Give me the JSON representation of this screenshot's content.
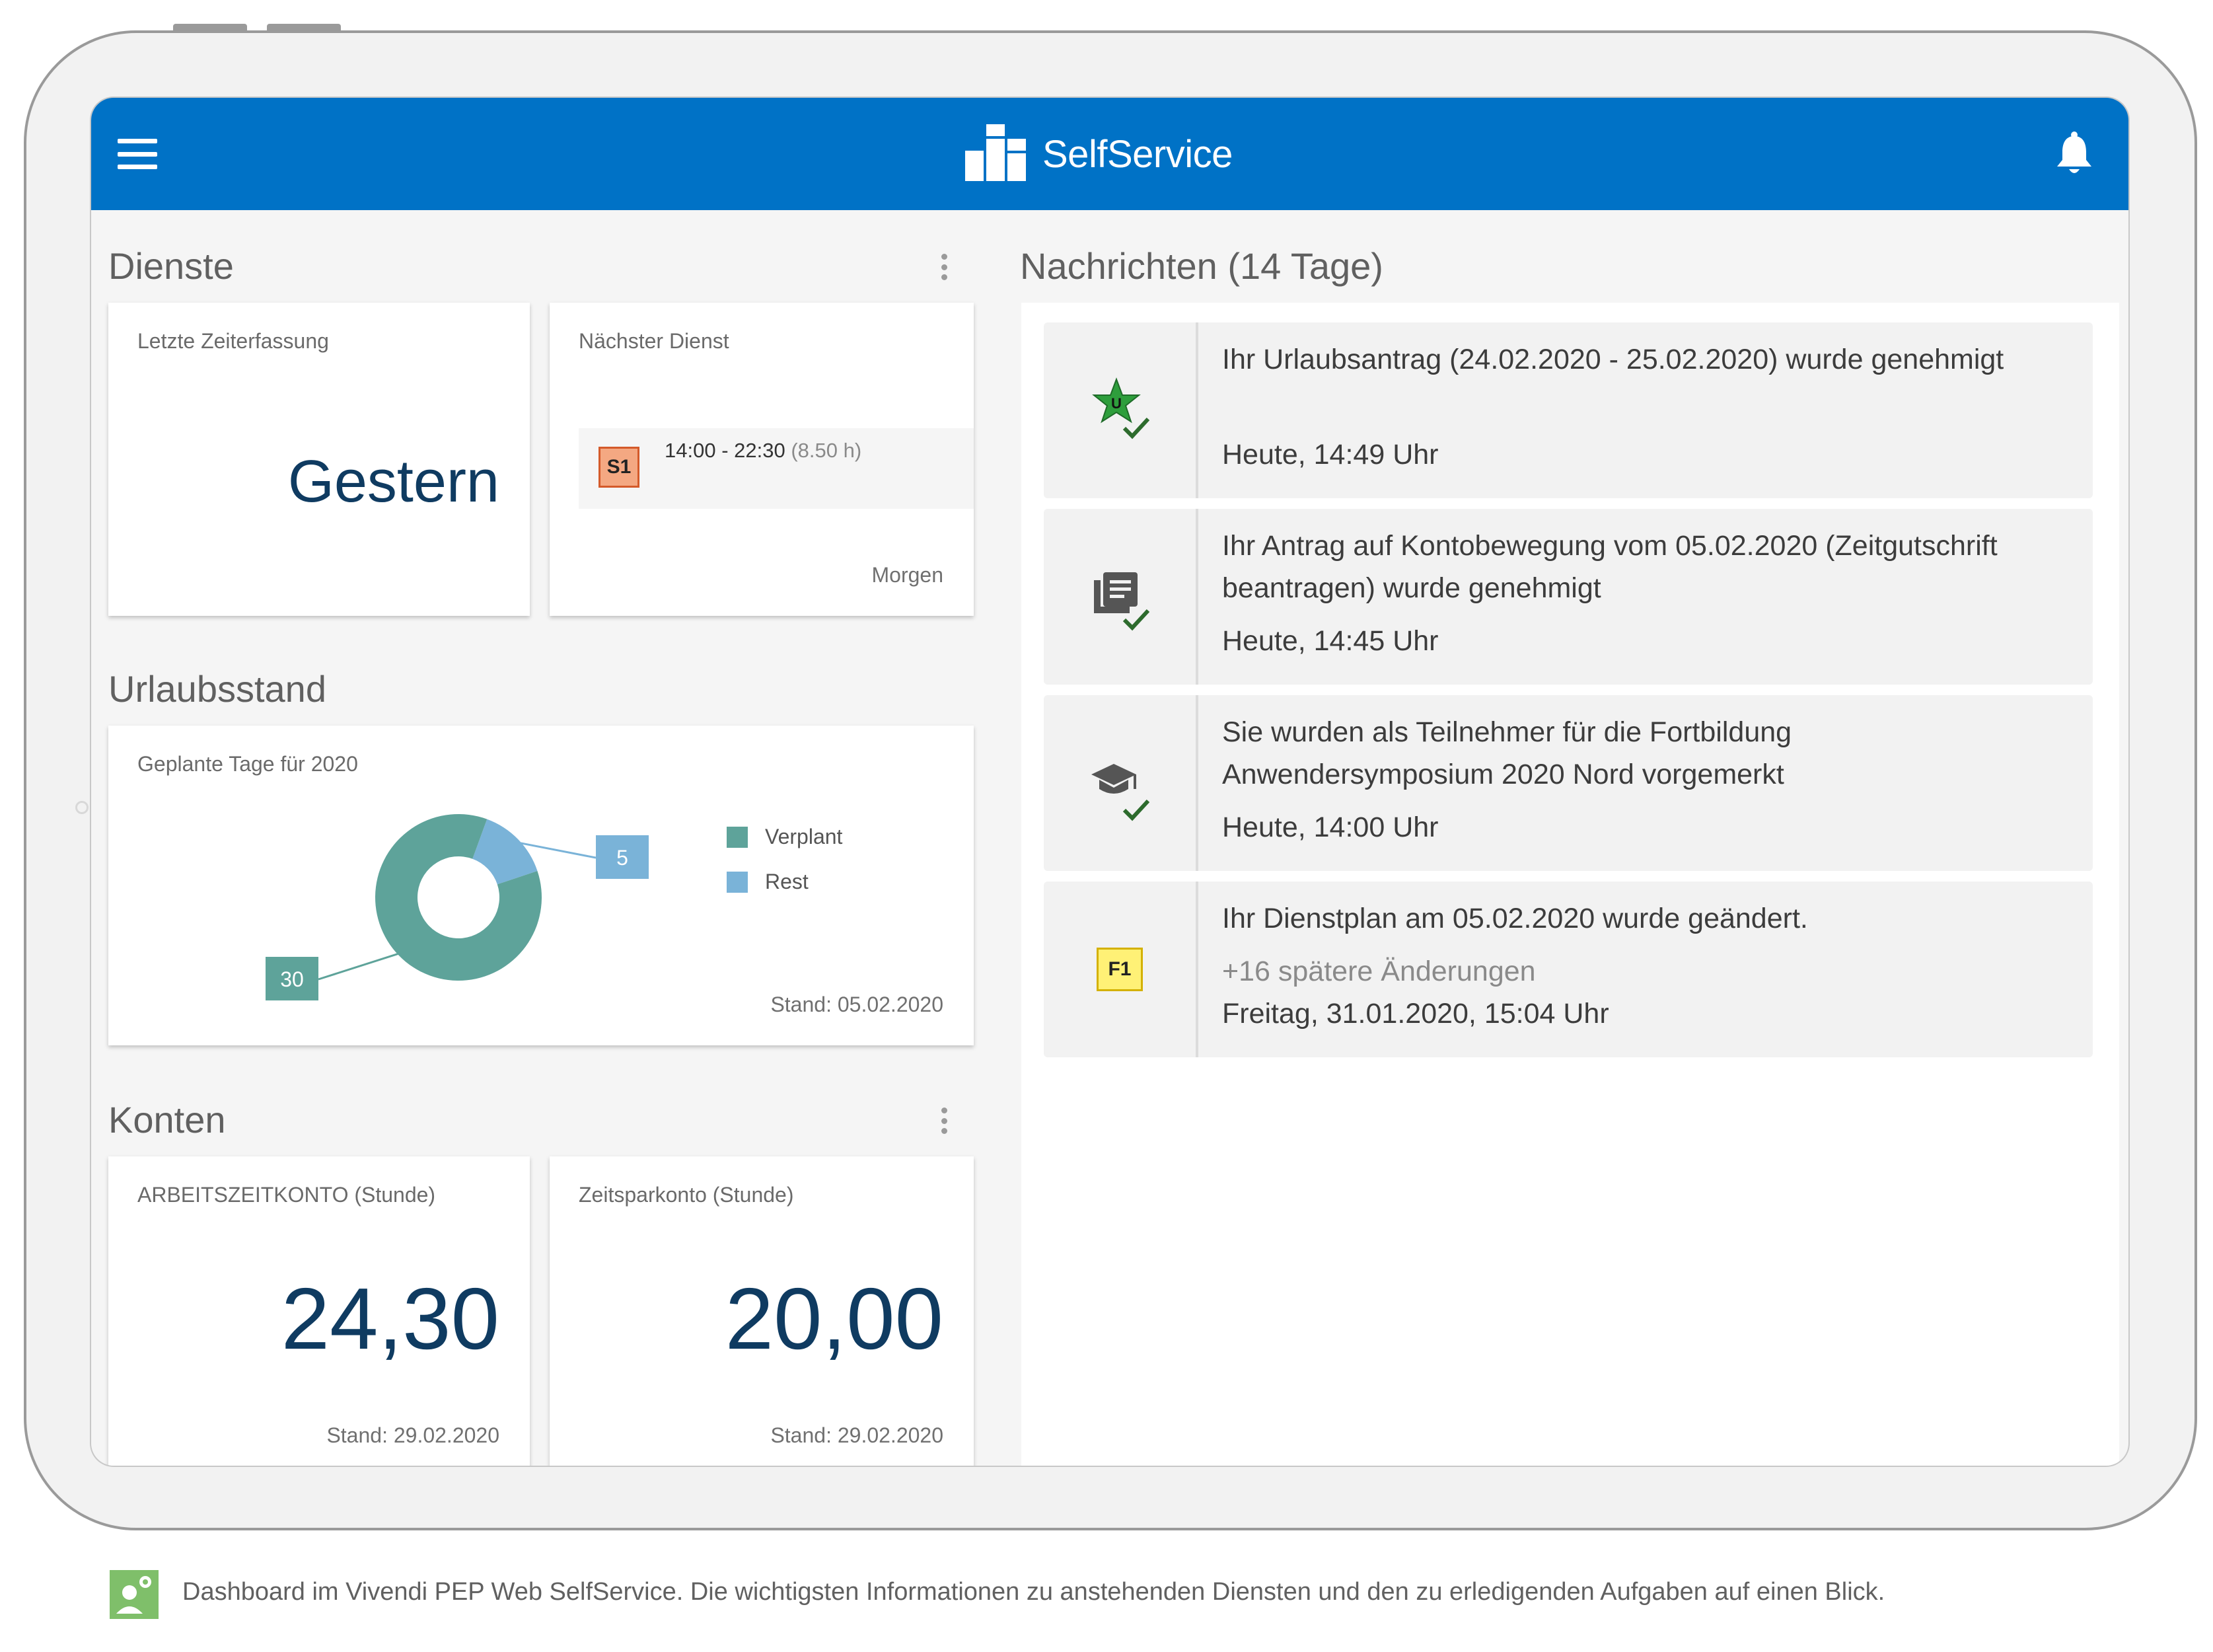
{
  "app": {
    "title": "SelfService"
  },
  "icons": {
    "menu": "hamburger-menu-icon",
    "logo": "selfservice-logo-icon",
    "notifications": "bell-icon"
  },
  "colors": {
    "appbar": "#0072c6",
    "value_text": "#0f3b61",
    "verplant": "#5ea39a",
    "rest": "#7ab3d8"
  },
  "dienste": {
    "title": "Dienste",
    "letzte": {
      "label": "Letzte Zeiterfassung",
      "value": "Gestern"
    },
    "naechster": {
      "label": "Nächster Dienst",
      "badge": "S1",
      "time": "14:00 - 22:30",
      "hours": "(8.50 h)",
      "day": "Morgen"
    }
  },
  "urlaub": {
    "title": "Urlaubsstand",
    "label": "Geplante Tage für 2020",
    "stand": "Stand: 05.02.2020",
    "legend": [
      "Verplant",
      "Rest"
    ],
    "chart_data": {
      "type": "pie",
      "categories": [
        "Verplant",
        "Rest"
      ],
      "values": [
        30,
        5
      ],
      "data_labels": [
        "30",
        "5"
      ]
    }
  },
  "konten": {
    "title": "Konten",
    "arbeitszeit": {
      "label": "ARBEITSZEITKONTO (Stunde)",
      "value": "24,30",
      "stand": "Stand: 29.02.2020"
    },
    "zeitspar": {
      "label": "Zeitsparkonto (Stunde)",
      "value": "20,00",
      "stand": "Stand: 29.02.2020"
    }
  },
  "nachrichten": {
    "title": "Nachrichten (14 Tage)",
    "items": [
      {
        "icon": "vacation-star-approved-icon",
        "text": "Ihr Urlaubsantrag (24.02.2020 - 25.02.2020) wurde genehmigt",
        "time": "Heute, 14:49 Uhr"
      },
      {
        "icon": "account-request-approved-icon",
        "text": "Ihr Antrag auf Kontobewegung vom 05.02.2020 (Zeitgutschrift beantragen) wurde genehmigt",
        "time": "Heute, 14:45 Uhr"
      },
      {
        "icon": "training-cap-approved-icon",
        "text": "Sie wurden als Teilnehmer für die Fortbildung Anwendersymposium 2020 Nord vorgemerkt",
        "time": "Heute, 14:00 Uhr"
      },
      {
        "icon": "shift-f1-badge-icon",
        "badge": "F1",
        "text": "Ihr Dienstplan am 05.02.2020 wurde geändert.",
        "more": "+16 spätere Änderungen",
        "time": "Freitag, 31.01.2020, 15:04 Uhr"
      }
    ]
  },
  "caption": "Dashboard im Vivendi PEP Web SelfService. Die wichtigsten Informationen zu anstehenden Diensten und den zu erledigenden Aufgaben auf einen Blick."
}
